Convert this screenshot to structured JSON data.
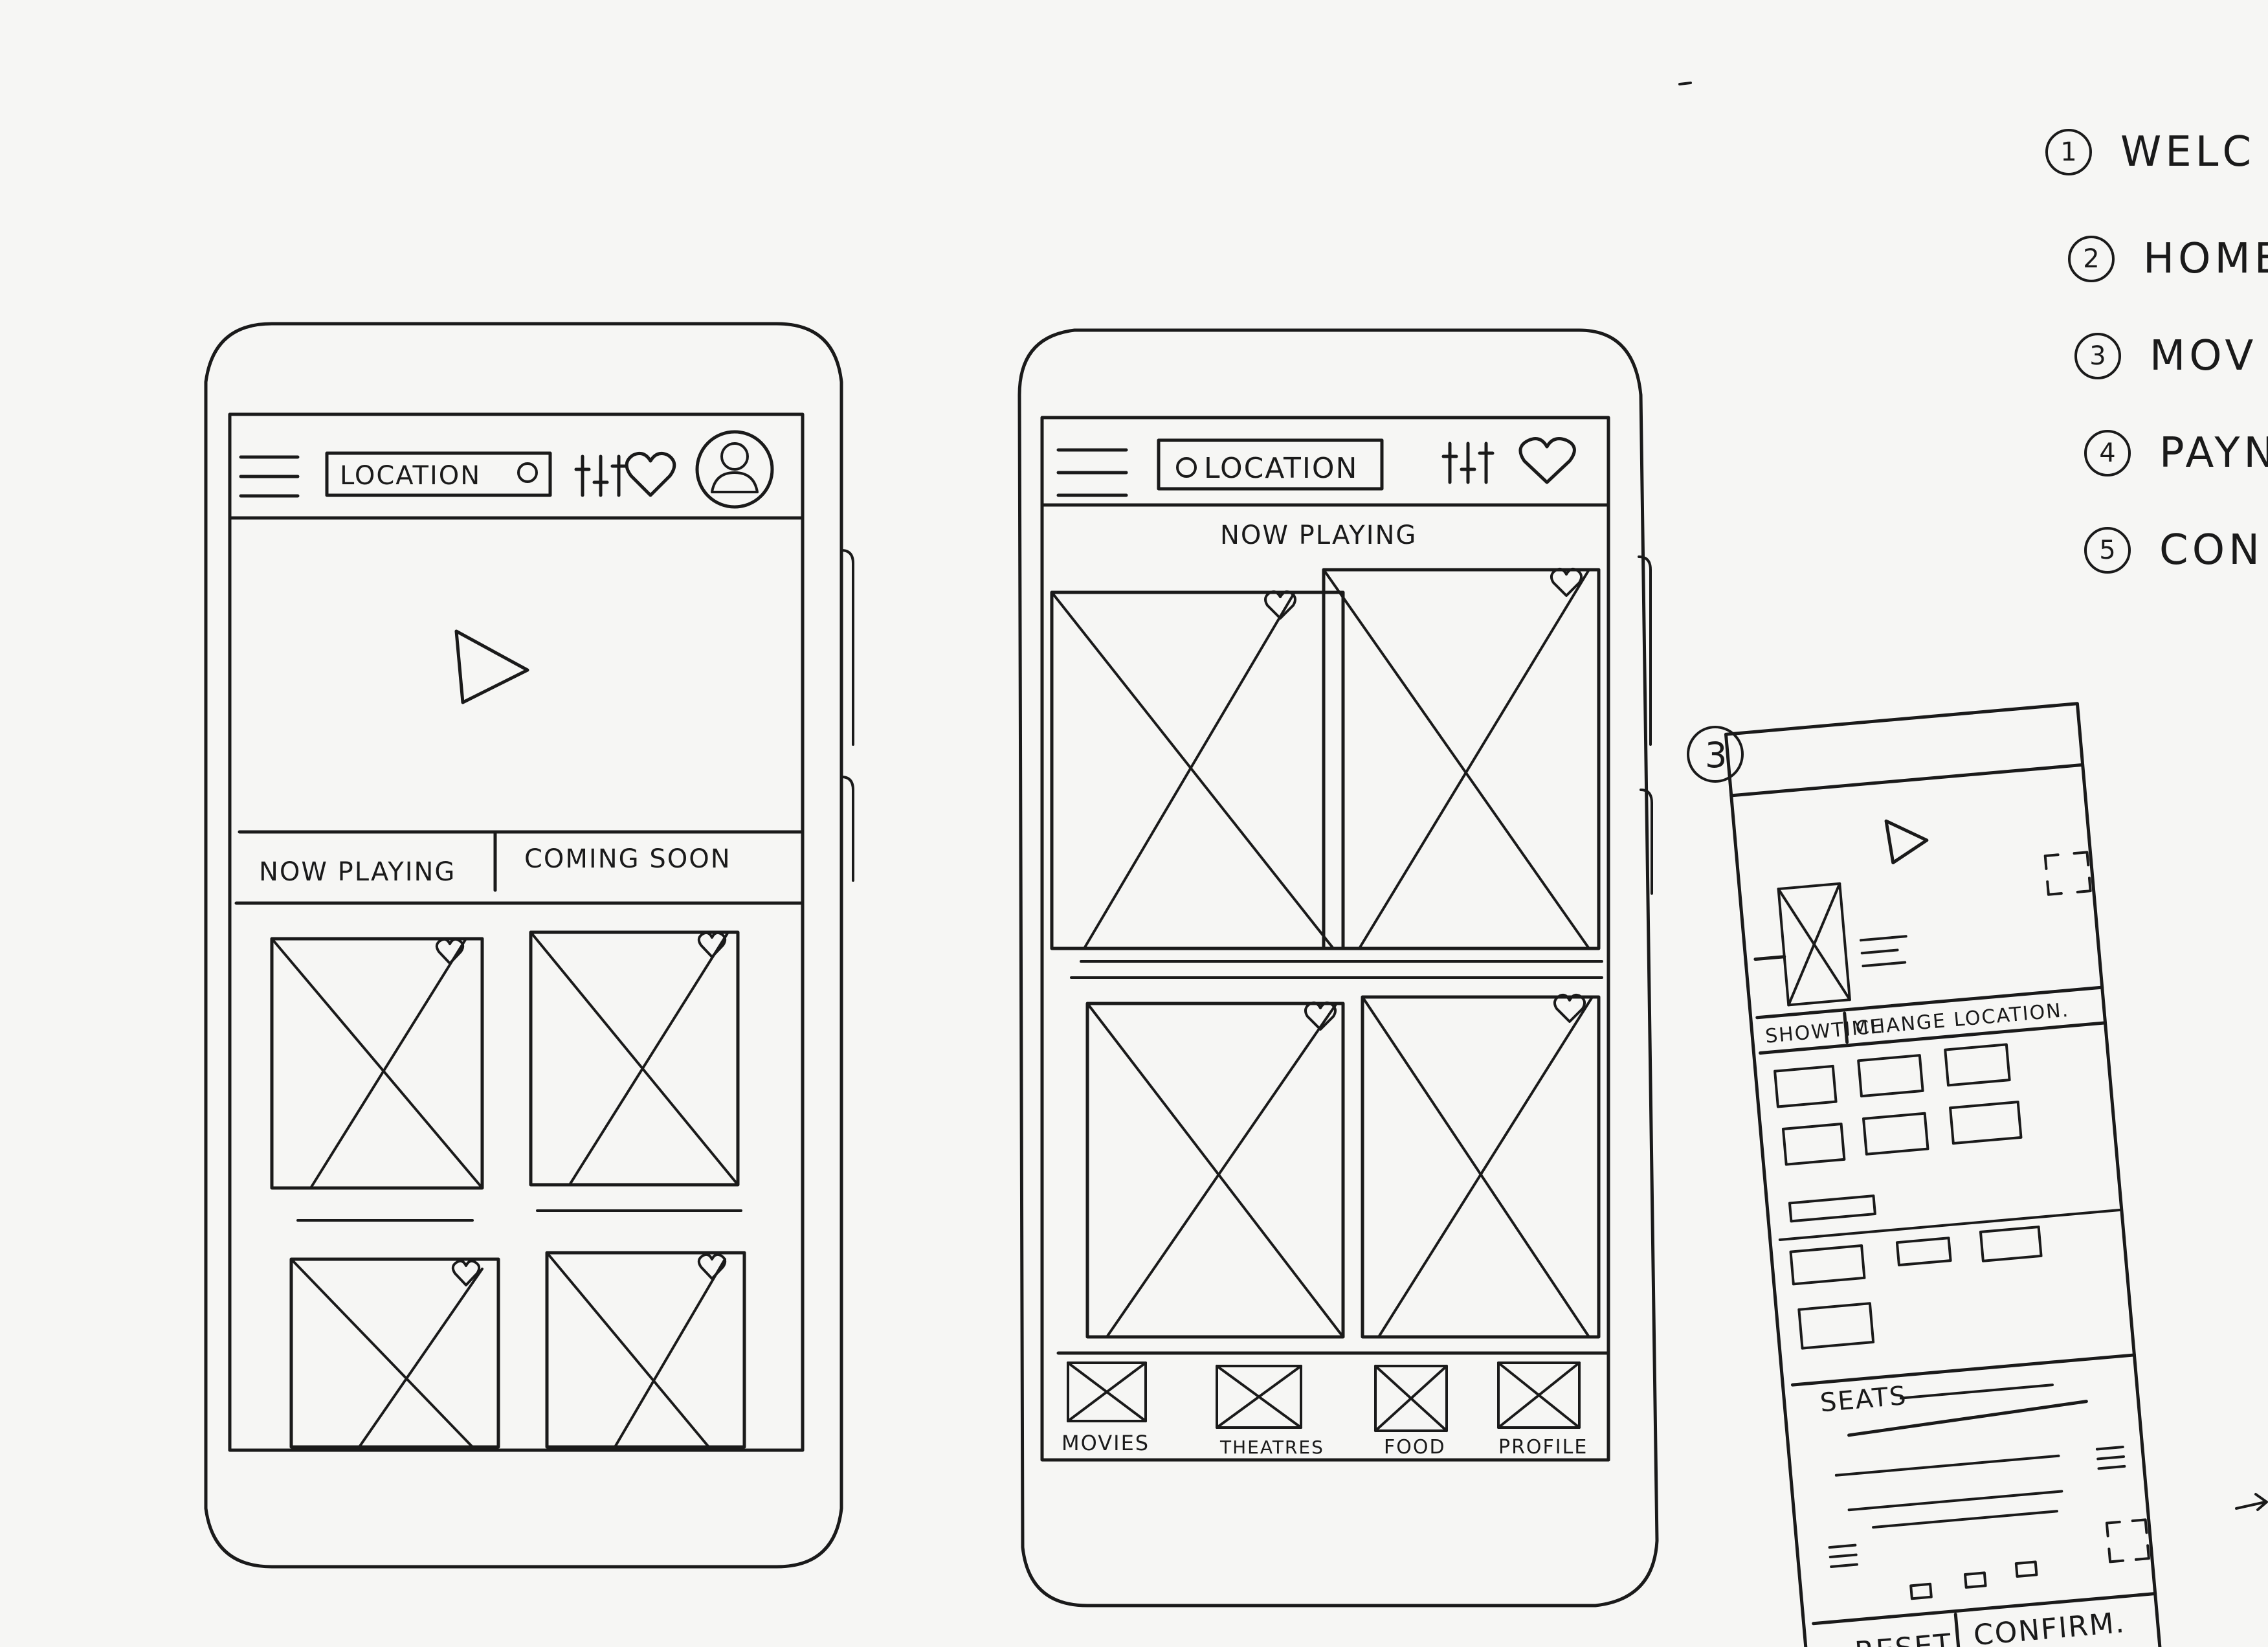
{
  "phone1": {
    "header": {
      "location_label": "LOCATION"
    },
    "tabs": [
      "NOW PLAYING",
      "COMING SOON"
    ]
  },
  "phone2": {
    "header": {
      "location_label": "LOCATION"
    },
    "section_title": "NOW PLAYING",
    "bottom_nav": [
      "MOVIES",
      "THEATRES",
      "FOOD",
      "PROFILE"
    ]
  },
  "legend": [
    {
      "num": "1",
      "label": "WELC"
    },
    {
      "num": "2",
      "label": "HOME"
    },
    {
      "num": "3",
      "label": "MOV"
    },
    {
      "num": "4",
      "label": "PAYN"
    },
    {
      "num": "5",
      "label": "CON"
    }
  ],
  "screen3": {
    "marker": "3",
    "tabs": [
      "SHOWTIME",
      "CHANGE LOCATION."
    ],
    "seats_label": "SEATS",
    "buttons": [
      "RESET",
      "CONFIRM."
    ]
  },
  "icons": [
    "menu-icon",
    "location-pin-icon",
    "filter-icon",
    "heart-icon",
    "profile-icon",
    "play-icon",
    "expand-icon",
    "image-placeholder-icon"
  ]
}
